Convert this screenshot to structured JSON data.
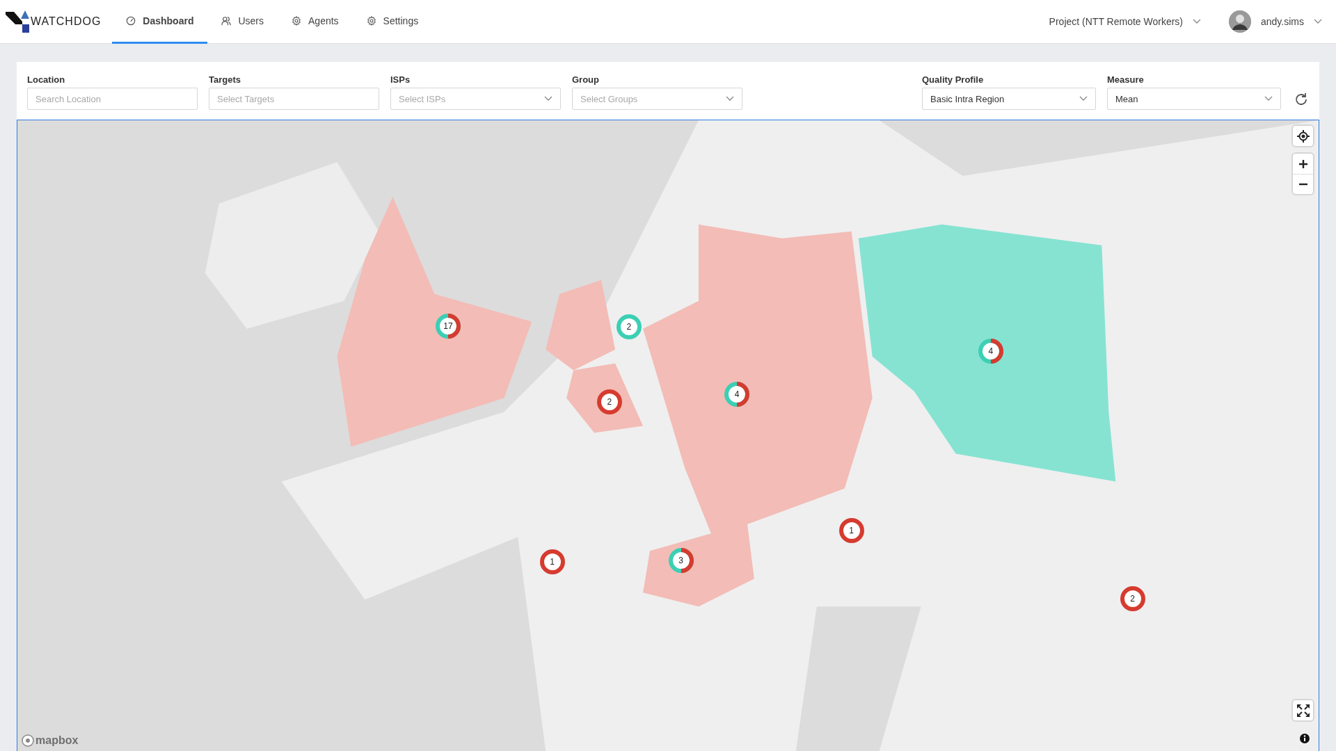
{
  "header": {
    "brand": "WATCHDOG",
    "tabs": [
      {
        "label": "Dashboard",
        "kind": "gauge",
        "selected": true
      },
      {
        "label": "Users",
        "kind": "users",
        "selected": false
      },
      {
        "label": "Agents",
        "kind": "gear",
        "selected": false
      },
      {
        "label": "Settings",
        "kind": "gear",
        "selected": false
      }
    ],
    "project": "Project (NTT Remote Workers)",
    "user": "andy.sims"
  },
  "filters": [
    {
      "label": "Location",
      "kind": "input",
      "placeholder": "Search Location"
    },
    {
      "label": "Targets",
      "kind": "input",
      "placeholder": "Select Targets"
    },
    {
      "label": "ISPs",
      "kind": "select",
      "placeholder": "Select ISPs"
    },
    {
      "label": "Group",
      "kind": "select",
      "placeholder": "Select Groups"
    }
  ],
  "profile_filters": [
    {
      "label": "Quality Profile",
      "kind": "select",
      "value": "Basic Intra Region"
    },
    {
      "label": "Measure",
      "kind": "select",
      "value": "Mean"
    }
  ],
  "map": {
    "attribution": "mapbox",
    "markers": [
      {
        "count": "17",
        "kind": "mixed"
      },
      {
        "count": "2",
        "kind": "good"
      },
      {
        "count": "2",
        "kind": "bad"
      },
      {
        "count": "4",
        "kind": "mixed"
      },
      {
        "count": "4",
        "kind": "mixed"
      },
      {
        "count": "1",
        "kind": "bad"
      },
      {
        "count": "3",
        "kind": "mixed"
      },
      {
        "count": "1",
        "kind": "bad"
      },
      {
        "count": "2",
        "kind": "bad"
      }
    ]
  }
}
